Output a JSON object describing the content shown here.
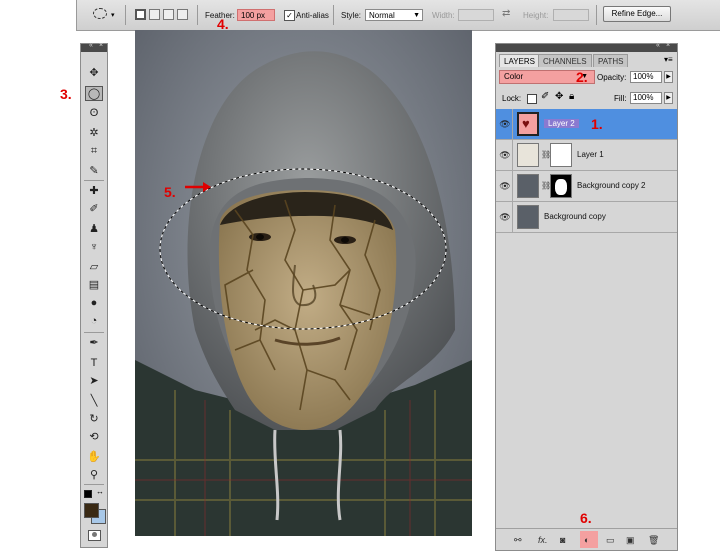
{
  "options_bar": {
    "feather_label": "Feather:",
    "feather_value": "100 px",
    "antialias_label": "Anti-alias",
    "antialias_checked": true,
    "style_label": "Style:",
    "style_value": "Normal",
    "width_label": "Width:",
    "height_label": "Height:",
    "refine_edge_label": "Refine Edge..."
  },
  "tools": {
    "items": [
      {
        "name": "move-tool",
        "glyph": "✥"
      },
      {
        "name": "elliptical-marquee-tool",
        "glyph": "◯",
        "selected": true
      },
      {
        "name": "lasso-tool",
        "glyph": "ʘ"
      },
      {
        "name": "magic-wand-tool",
        "glyph": "✲"
      },
      {
        "name": "crop-tool",
        "glyph": "⌗"
      },
      {
        "name": "eyedropper-tool",
        "glyph": "✎"
      },
      {
        "name": "spot-healing-tool",
        "glyph": "✚"
      },
      {
        "name": "brush-tool",
        "glyph": "✐"
      },
      {
        "name": "clone-stamp-tool",
        "glyph": "♟"
      },
      {
        "name": "history-brush-tool",
        "glyph": "♆"
      },
      {
        "name": "eraser-tool",
        "glyph": "▱"
      },
      {
        "name": "gradient-tool",
        "glyph": "▤"
      },
      {
        "name": "blur-tool",
        "glyph": "●"
      },
      {
        "name": "dodge-tool",
        "glyph": "◔"
      },
      {
        "name": "pen-tool",
        "glyph": "✒"
      },
      {
        "name": "type-tool",
        "glyph": "T"
      },
      {
        "name": "path-selection-tool",
        "glyph": "➤"
      },
      {
        "name": "line-tool",
        "glyph": "╲"
      },
      {
        "name": "3d-rotate-tool",
        "glyph": "↻"
      },
      {
        "name": "3d-orbit-tool",
        "glyph": "⟲"
      },
      {
        "name": "hand-tool",
        "glyph": "✋"
      },
      {
        "name": "zoom-tool",
        "glyph": "⚲"
      }
    ],
    "foreground_color": "#3a2a14",
    "background_color": "#a8c8e8"
  },
  "layers_panel": {
    "tabs": [
      "LAYERS",
      "CHANNELS",
      "PATHS"
    ],
    "active_tab": "LAYERS",
    "blend_mode": "Color",
    "opacity_label": "Opacity:",
    "opacity_value": "100%",
    "lock_label": "Lock:",
    "fill_label": "Fill:",
    "fill_value": "100%",
    "layers": [
      {
        "name": "Layer 2",
        "selected": true
      },
      {
        "name": "Layer 1",
        "selected": false
      },
      {
        "name": "Background copy 2",
        "selected": false
      },
      {
        "name": "Background copy",
        "selected": false
      }
    ]
  },
  "callouts": {
    "one": "1.",
    "two": "2.",
    "three": "3.",
    "four": "4.",
    "five": "5.",
    "six": "6."
  },
  "colors": {
    "highlight": "#f4a0a0",
    "selected_layer": "#4f8fe0",
    "callout": "#e00000"
  }
}
